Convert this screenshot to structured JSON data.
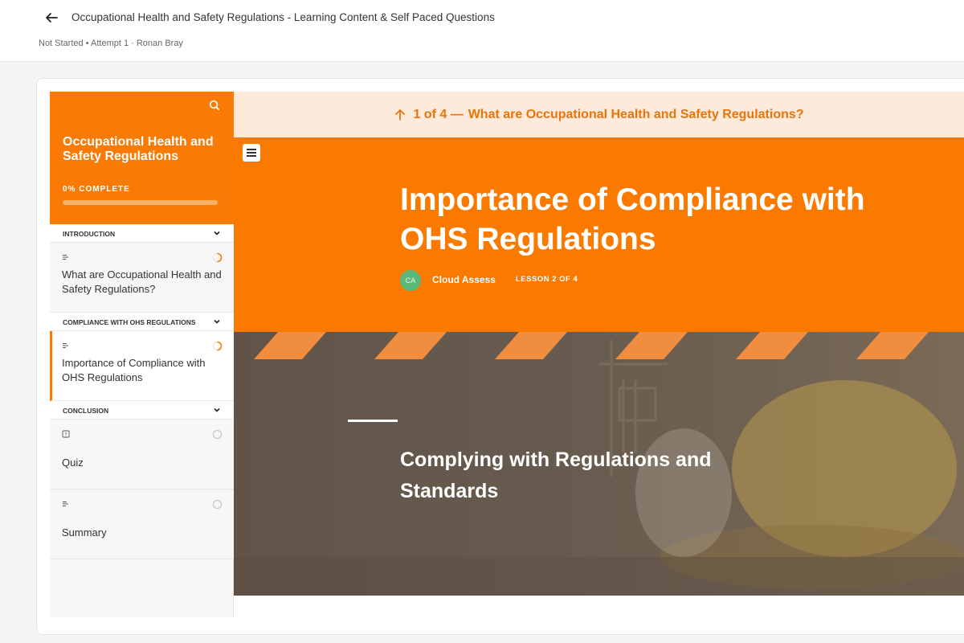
{
  "header": {
    "course_title": "Occupational Health and Safety Regulations - Learning Content & Self Paced Questions",
    "meta": "Not Started • Attempt 1 · Ronan Bray"
  },
  "sidebar": {
    "title": "Occupational Health and Safety Regulations",
    "progress_label": "0% COMPLETE",
    "progress_fraction": 0,
    "sections": [
      {
        "label": "INTRODUCTION"
      },
      {
        "label": "COMPLIANCE WITH OHS REGULATIONS"
      },
      {
        "label": "CONCLUSION"
      }
    ],
    "lessons": [
      {
        "title": "What are Occupational Health and Safety Regulations?",
        "icon": "text-lines-icon",
        "status": "in-progress"
      },
      {
        "title": "Importance of Compliance with OHS Regulations",
        "icon": "text-lines-icon",
        "status": "in-progress",
        "active": true
      },
      {
        "title": "Quiz",
        "icon": "quiz-icon",
        "status": "not-started"
      },
      {
        "title": "Summary",
        "icon": "text-lines-icon",
        "status": "not-started"
      }
    ]
  },
  "lesson_nav": {
    "number": "1 of 4 —",
    "title": "What are Occupational Health and Safety Regulations?"
  },
  "hero": {
    "title": "Importance of Compliance with OHS Regulations",
    "avatar_initials": "CA",
    "author": "Cloud Assess",
    "lesson_count": "LESSON 2 OF 4"
  },
  "banner": {
    "title": "Complying with Regulations and Standards"
  },
  "colors": {
    "accent": "#f97b05",
    "nav_bg": "#fdeadb",
    "nav_text": "#e8740c",
    "avatar": "#5cb87a"
  }
}
